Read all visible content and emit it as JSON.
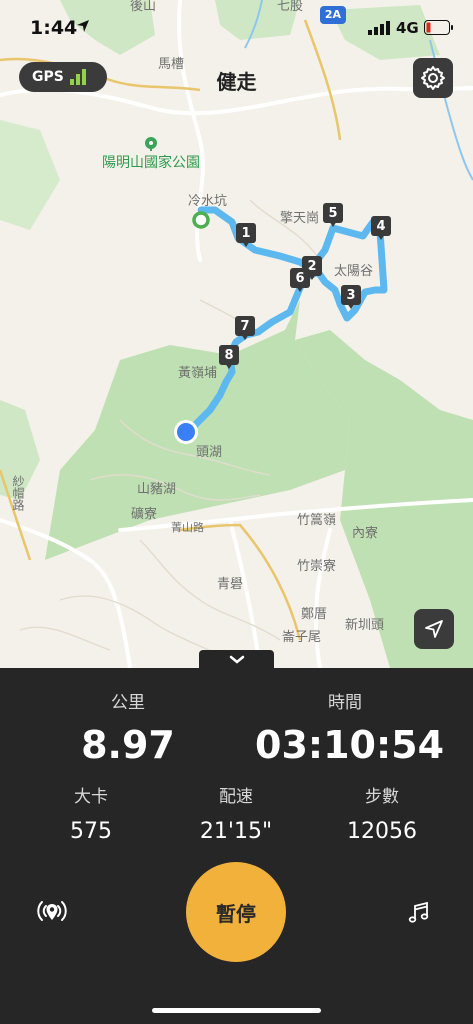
{
  "status_bar": {
    "time": "1:44",
    "network": "4G"
  },
  "header": {
    "title": "健走",
    "gps_label": "GPS"
  },
  "map": {
    "labels": {
      "houshan": "後山",
      "qigu": "七股",
      "route_badge": "2A",
      "macao": "馬槽",
      "park": "陽明山國家公園",
      "lengshuikeng": "冷水坑",
      "qingtiangang": "擎天崗",
      "taiyanggu": "太陽谷",
      "huanglingpu": "黃嶺埔",
      "toulu": "頭湖",
      "shanzhuhu": "山豬湖",
      "kuangliao": "礦寮",
      "jingshan_road": "菁山路",
      "shadi_road": "紗帽路",
      "zhuzanling": "竹篙嶺",
      "neiliao": "內寮",
      "zhuchongliao": "竹崇寮",
      "qingcuo": "青礐",
      "zhengcuo": "鄭厝",
      "xinzhutou": "新圳頭",
      "jiziwei": "崙子尾"
    },
    "route_markers": [
      "1",
      "2",
      "3",
      "4",
      "5",
      "6",
      "7",
      "8"
    ]
  },
  "stats": {
    "distance": {
      "label": "公里",
      "value": "8.97"
    },
    "duration": {
      "label": "時間",
      "value": "03:10:54"
    },
    "calories": {
      "label": "大卡",
      "value": "575"
    },
    "pace": {
      "label": "配速",
      "value": "21'15\""
    },
    "steps": {
      "label": "步數",
      "value": "12056"
    }
  },
  "controls": {
    "pause_label": "暫停"
  },
  "colors": {
    "route": "#5cb8ee",
    "park_fill": "#bfe0b3",
    "pause_button": "#f2b13a",
    "panel_bg": "#262626",
    "gps_bars": "#8fd34a",
    "current_location": "#3a7ff5",
    "start_point": "#4caf50"
  },
  "icons": {
    "location_arrow": "location-arrow-icon",
    "settings": "gear-icon",
    "locate": "navigation-arrow-icon",
    "collapse": "chevron-down-icon",
    "beacon": "live-beacon-icon",
    "music": "music-note-icon"
  }
}
